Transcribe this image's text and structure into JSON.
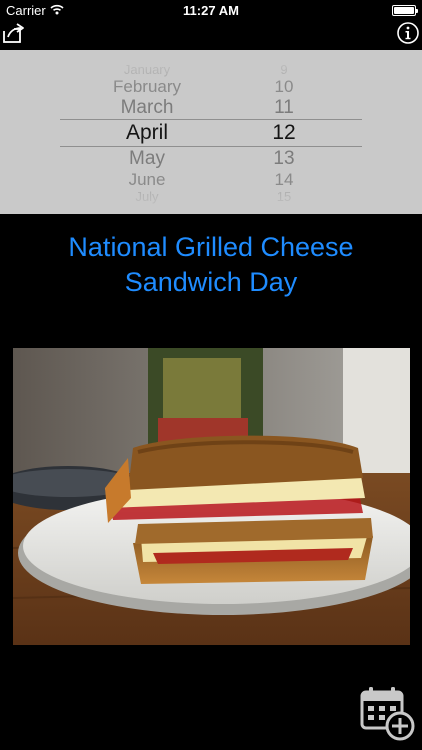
{
  "status_bar": {
    "carrier": "Carrier",
    "time": "11:27 AM",
    "battery_level": 1.0
  },
  "toolbar": {
    "share_icon": "share-icon",
    "info_icon": "info-icon"
  },
  "picker": {
    "months": [
      "January",
      "February",
      "March",
      "April",
      "May",
      "June",
      "July"
    ],
    "days": [
      "9",
      "10",
      "11",
      "12",
      "13",
      "14",
      "15"
    ],
    "selected_month": "April",
    "selected_day": "12"
  },
  "holiday": {
    "title": "National Grilled Cheese Sandwich Day"
  },
  "photo": {
    "subject": "grilled cheese sandwich"
  },
  "actions": {
    "calendar_add_icon": "calendar-add-icon"
  }
}
